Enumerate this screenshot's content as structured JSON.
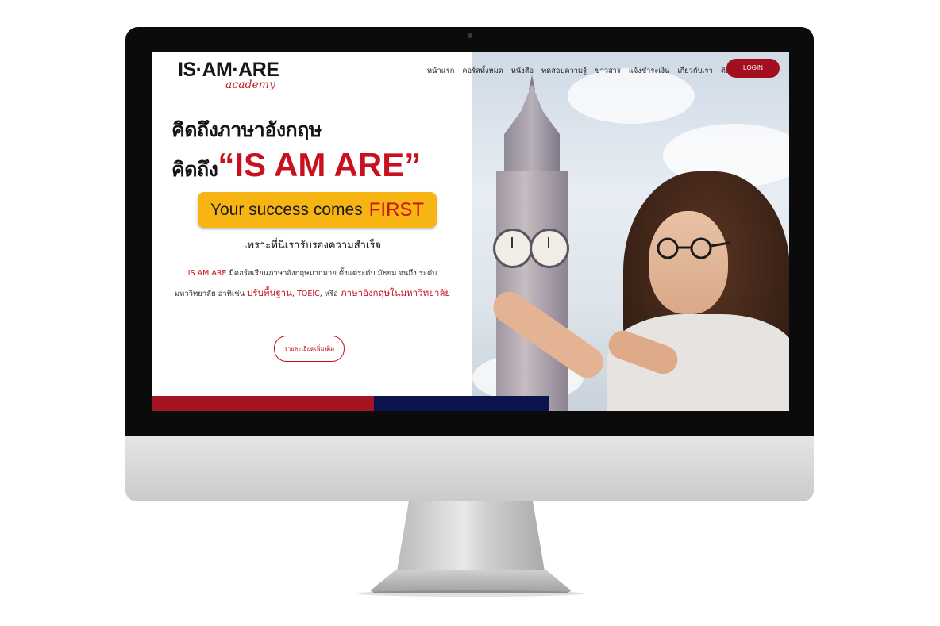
{
  "nav": {
    "logo_main": "IS·AM·ARE",
    "logo_sub": "academy",
    "items": [
      "หน้าแรก",
      "คอร์สทั้งหมด",
      "หนังสือ",
      "ทดสอบความรู้",
      "ข่าวสาร",
      "แจ้งชำระเงิน",
      "เกี่ยวกับเรา",
      "ติดต่อเรา"
    ],
    "login_label": "LOGIN"
  },
  "hero": {
    "line1": "คิดถึงภาษาอังกฤษ",
    "line2_prefix": "คิดถึง",
    "line2_brand": "“IS AM ARE”",
    "banner_text": "Your success comes",
    "banner_highlight": "FIRST",
    "guarantee": "เพราะที่นี่เรารับรองความสำเร็จ",
    "para_brand": "IS AM ARE",
    "para_line1": "มีคอร์สเรียนภาษาอังกฤษมากมาย ตั้งแต่ระดับ มัธยม จนถึง ระดับ",
    "para_line2_start": "มหาวิทยาลัย อาทิเช่น",
    "para_hl1": "ปรับพื้นฐาน",
    "para_sep1": ",",
    "para_hl2": "TOEIC",
    "para_sep2": ", หรือ",
    "para_hl3": "ภาษาอังกฤษในมหาวิทยาลัย",
    "more_button": "รายละเอียดเพิ่มเติม"
  },
  "colors": {
    "accent_red": "#c8101e",
    "banner_yellow": "#f6b512",
    "bar_red": "#a51422",
    "bar_navy": "#0c1450",
    "login_bg": "#a30f1e"
  }
}
